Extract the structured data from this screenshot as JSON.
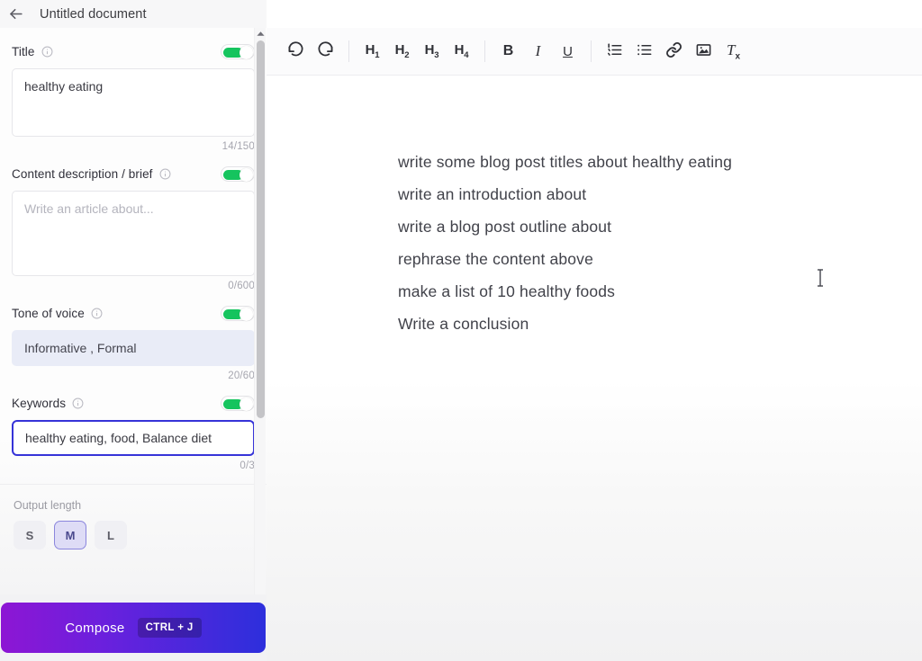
{
  "header": {
    "back_icon": "back-arrow-icon",
    "document_title": "Untitled document",
    "view_toggles": [
      {
        "name": "preview-view",
        "icon": "eye-icon",
        "active": true
      },
      {
        "name": "split-view",
        "icon": "split-panel-icon",
        "active": false
      }
    ]
  },
  "sidebar": {
    "fields": [
      {
        "label": "Title",
        "info_icon": "info-icon",
        "toggle_on": true,
        "value": "healthy eating",
        "placeholder": "",
        "counter": "14/150"
      },
      {
        "label": "Content description / brief",
        "info_icon": "info-icon",
        "toggle_on": true,
        "value": "",
        "placeholder": "Write an article about...",
        "counter": "0/600"
      },
      {
        "label": "Tone of voice",
        "info_icon": "info-icon",
        "toggle_on": true,
        "value": "Informative , Formal",
        "placeholder": "",
        "counter": "20/60"
      },
      {
        "label": "Keywords",
        "info_icon": "info-icon",
        "toggle_on": true,
        "value": "healthy eating, food, Balance diet",
        "placeholder": "",
        "counter": "0/3"
      }
    ],
    "output_length": {
      "label": "Output length",
      "options": [
        "S",
        "M",
        "L"
      ],
      "selected": "M"
    },
    "compose": {
      "label": "Compose",
      "shortcut": "CTRL + J"
    },
    "scrollbar": {
      "up_arrow_icon": "caret-up-icon"
    }
  },
  "toolbar": {
    "groups": [
      [
        {
          "name": "undo-button",
          "icon": "undo-icon",
          "label": ""
        },
        {
          "name": "redo-button",
          "icon": "redo-icon",
          "label": ""
        }
      ],
      [
        {
          "name": "heading-1-button",
          "icon": "h1-icon",
          "label": "H",
          "sub": "1"
        },
        {
          "name": "heading-2-button",
          "icon": "h2-icon",
          "label": "H",
          "sub": "2"
        },
        {
          "name": "heading-3-button",
          "icon": "h3-icon",
          "label": "H",
          "sub": "3"
        },
        {
          "name": "heading-4-button",
          "icon": "h4-icon",
          "label": "H",
          "sub": "4"
        }
      ],
      [
        {
          "name": "bold-button",
          "icon": "bold-icon",
          "label": "B"
        },
        {
          "name": "italic-button",
          "icon": "italic-icon",
          "label": "I"
        },
        {
          "name": "underline-button",
          "icon": "underline-icon",
          "label": "U"
        }
      ],
      [
        {
          "name": "ordered-list-button",
          "icon": "ordered-list-icon",
          "label": ""
        },
        {
          "name": "bullet-list-button",
          "icon": "bullet-list-icon",
          "label": ""
        },
        {
          "name": "link-button",
          "icon": "link-icon",
          "label": ""
        },
        {
          "name": "image-button",
          "icon": "image-icon",
          "label": ""
        },
        {
          "name": "clear-formatting-button",
          "icon": "clear-format-icon",
          "label": ""
        }
      ]
    ]
  },
  "editor": {
    "lines": [
      "write some blog post titles about healthy eating",
      "write an introduction about",
      "write a blog post outline about",
      "rephrase the content above",
      "make a list of 10 healthy foods",
      "Write a conclusion"
    ]
  },
  "colors": {
    "toggle_on": "#15c45e",
    "focus_border": "#3633d8",
    "accent_purple": "#8b86dd",
    "compose_gradient_start": "#8d16d4",
    "compose_gradient_end": "#2d2fdc",
    "tone_field_bg": "#e9ecf7"
  }
}
